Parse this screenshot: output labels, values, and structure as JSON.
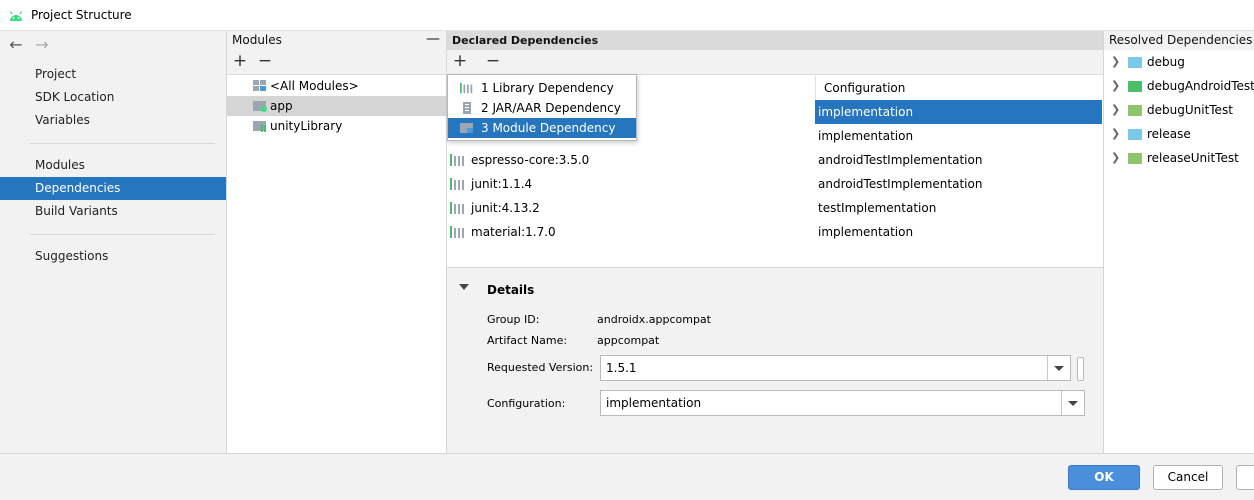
{
  "window": {
    "title": "Project Structure"
  },
  "nav": {
    "items": [
      "Project",
      "SDK Location",
      "Variables",
      "Modules",
      "Dependencies",
      "Build Variants",
      "Suggestions"
    ],
    "selected": "Dependencies"
  },
  "modules_panel": {
    "title": "Modules",
    "add_label": "+",
    "remove_label": "−",
    "items": [
      "<All Modules>",
      "app",
      "unityLibrary"
    ],
    "selected": "app"
  },
  "declared_panel": {
    "title": "Declared Dependencies",
    "add_label": "+",
    "remove_label": "−",
    "column_configuration": "Configuration",
    "rows": [
      {
        "name": "",
        "configuration": "implementation"
      },
      {
        "name": "",
        "configuration": "implementation"
      },
      {
        "name": "espresso-core:3.5.0",
        "configuration": "androidTestImplementation"
      },
      {
        "name": "junit:1.1.4",
        "configuration": "androidTestImplementation"
      },
      {
        "name": "junit:4.13.2",
        "configuration": "testImplementation"
      },
      {
        "name": "material:1.7.0",
        "configuration": "implementation"
      }
    ]
  },
  "popup": {
    "items": [
      "1  Library Dependency",
      "2  JAR/AAR Dependency",
      "3  Module Dependency"
    ],
    "selected": "3  Module Dependency"
  },
  "details": {
    "title": "Details",
    "group_id_label": "Group ID:",
    "group_id": "androidx.appcompat",
    "artifact_label": "Artifact Name:",
    "artifact": "appcompat",
    "requested_version_label": "Requested Version:",
    "requested_version": "1.5.1",
    "configuration_label": "Configuration:",
    "configuration": "implementation"
  },
  "resolved_panel": {
    "title": "Resolved Dependencies",
    "items": [
      {
        "label": "debug",
        "color": "#7cc8ea"
      },
      {
        "label": "debugAndroidTest",
        "color": "#4cbe6a"
      },
      {
        "label": "debugUnitTest",
        "color": "#8fc46a"
      },
      {
        "label": "release",
        "color": "#7cc8ea"
      },
      {
        "label": "releaseUnitTest",
        "color": "#8fc46a"
      }
    ]
  },
  "footer": {
    "ok_label": "OK",
    "cancel_label": "Cancel"
  },
  "colors": {
    "accent": "#2675bf",
    "android_green": "#3ddc84"
  }
}
